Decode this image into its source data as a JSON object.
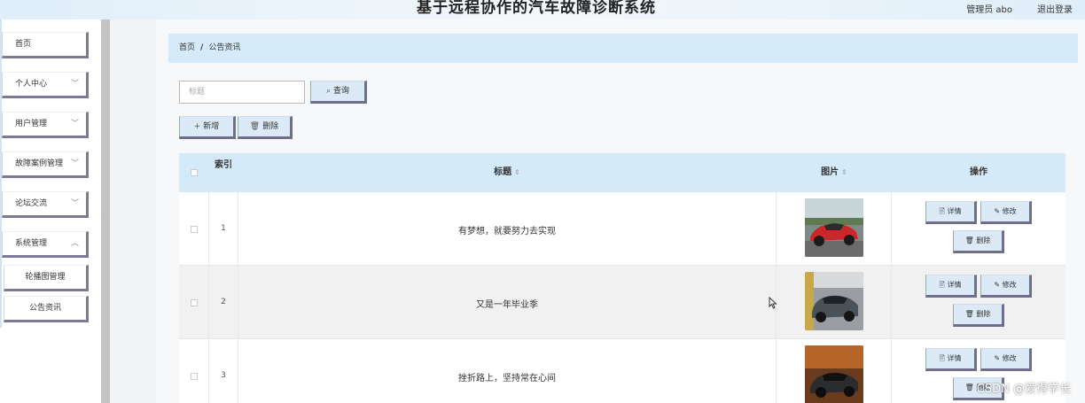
{
  "header": {
    "title": "基于远程协作的汽车故障诊断系统",
    "user": "管理员 abo",
    "logout": "退出登录"
  },
  "sidebar": {
    "items": [
      {
        "label": "首页",
        "has_chevron": false
      },
      {
        "label": "个人中心",
        "has_chevron": true
      },
      {
        "label": "用户管理",
        "has_chevron": true
      },
      {
        "label": "故障案例管理",
        "has_chevron": true
      },
      {
        "label": "论坛交流",
        "has_chevron": true
      },
      {
        "label": "系统管理",
        "has_chevron": true
      }
    ],
    "sub_items": [
      {
        "label": "轮播图管理"
      },
      {
        "label": "公告资讯"
      }
    ]
  },
  "breadcrumb": {
    "home": "首页",
    "separator": "/",
    "current": "公告资讯"
  },
  "search": {
    "placeholder": "标题",
    "button_label": "查询"
  },
  "toolbar": {
    "add_label": "新增",
    "delete_label": "删除"
  },
  "table": {
    "headers": {
      "index": "索引",
      "title": "标题",
      "image": "图片",
      "actions": "操作"
    },
    "rows": [
      {
        "index": "1",
        "title": "有梦想，就要努力去实现",
        "image": "red-sports-car"
      },
      {
        "index": "2",
        "title": "又是一年毕业季",
        "image": "grey-sports-car"
      },
      {
        "index": "3",
        "title": "挫折路上，坚持常在心间",
        "image": "black-sports-car"
      }
    ],
    "action_labels": {
      "detail": "详情",
      "edit": "修改",
      "delete": "删除"
    }
  },
  "watermark": "CSDN @爱得学长",
  "colors": {
    "accent_light_blue": "#d6ebf9",
    "button_border": "#6f6f8c",
    "header_bg": "#dfeefa"
  }
}
